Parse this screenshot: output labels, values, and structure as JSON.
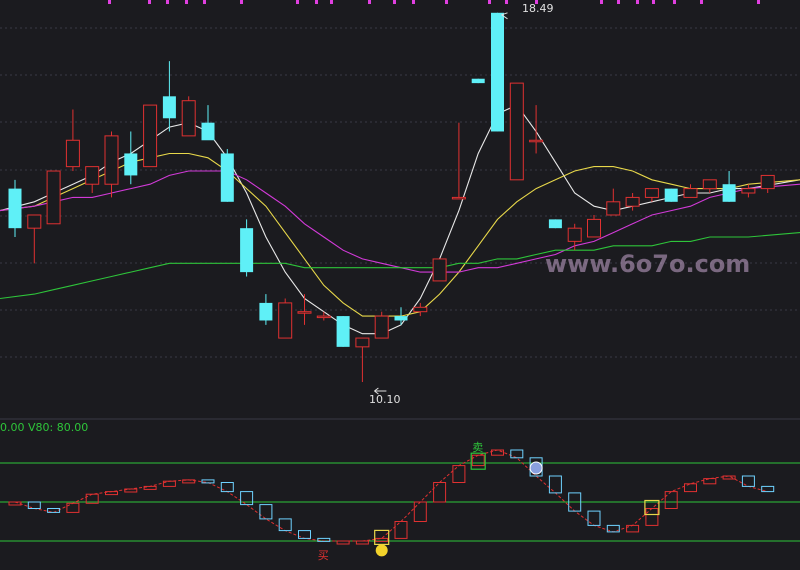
{
  "watermark": "www.6o7o.com",
  "main_chart": {
    "high_label": "18.49",
    "low_label": "10.10"
  },
  "indicator": {
    "header": "0.00  V80: 80.00",
    "icon_sell_text": "卖",
    "icon_buy_text": "买"
  },
  "colors": {
    "up": "#e03131",
    "down": "#5ff0f7",
    "ma_white": "#e8e8e8",
    "ma_yellow": "#e8d84a",
    "ma_magenta": "#d23ad8",
    "ma_green": "#2ec43a",
    "grid": "#3a3a44",
    "hline": "#2ec43a",
    "osc_line": "#e03131",
    "osc_box_up": "#e03131",
    "osc_box_down": "#6fd2ff",
    "signal_box": "#e8d84a",
    "signal_box_green": "#2ec43a",
    "header": "#2ec43a",
    "top_ticks": "#e040e0"
  },
  "chart_data": [
    {
      "type": "candlestick",
      "title": "",
      "annotations": [
        "18.49",
        "10.10"
      ],
      "ylim": [
        9.6,
        18.7
      ],
      "series": [
        {
          "name": "",
          "open": 14.5,
          "high": 14.7,
          "low": 13.4,
          "close": 13.6
        },
        {
          "name": "",
          "open": 13.6,
          "high": 13.8,
          "low": 12.8,
          "close": 13.9
        },
        {
          "name": "",
          "open": 13.7,
          "high": 14.9,
          "low": 13.7,
          "close": 14.9
        },
        {
          "name": "",
          "open": 15.0,
          "high": 16.3,
          "low": 14.9,
          "close": 15.6
        },
        {
          "name": "",
          "open": 14.6,
          "high": 15.0,
          "low": 14.4,
          "close": 15.0
        },
        {
          "name": "",
          "open": 14.6,
          "high": 15.8,
          "low": 14.3,
          "close": 15.7
        },
        {
          "name": "",
          "open": 15.3,
          "high": 15.8,
          "low": 14.6,
          "close": 14.8
        },
        {
          "name": "",
          "open": 15.0,
          "high": 16.2,
          "low": 15.0,
          "close": 16.4
        },
        {
          "name": "",
          "open": 16.6,
          "high": 17.4,
          "low": 15.8,
          "close": 16.1
        },
        {
          "name": "",
          "open": 15.7,
          "high": 16.6,
          "low": 15.7,
          "close": 16.5
        },
        {
          "name": "",
          "open": 16.0,
          "high": 16.4,
          "low": 15.7,
          "close": 15.6
        },
        {
          "name": "",
          "open": 15.3,
          "high": 15.4,
          "low": 14.2,
          "close": 14.2
        },
        {
          "name": "",
          "open": 13.6,
          "high": 13.8,
          "low": 12.5,
          "close": 12.6
        },
        {
          "name": "",
          "open": 11.9,
          "high": 12.1,
          "low": 11.4,
          "close": 11.5
        },
        {
          "name": "",
          "open": 11.1,
          "high": 12.0,
          "low": 11.1,
          "close": 11.9
        },
        {
          "name": "",
          "open": 11.7,
          "high": 12.1,
          "low": 11.4,
          "close": 11.7
        },
        {
          "name": "",
          "open": 11.6,
          "high": 11.7,
          "low": 11.5,
          "close": 11.6
        },
        {
          "name": "",
          "open": 11.6,
          "high": 11.6,
          "low": 10.9,
          "close": 10.9
        },
        {
          "name": "",
          "open": 10.9,
          "high": 11.1,
          "low": 10.1,
          "close": 11.1
        },
        {
          "name": "",
          "open": 11.1,
          "high": 11.7,
          "low": 11.1,
          "close": 11.6
        },
        {
          "name": "",
          "open": 11.6,
          "high": 11.8,
          "low": 11.4,
          "close": 11.5
        },
        {
          "name": "",
          "open": 11.7,
          "high": 11.9,
          "low": 11.6,
          "close": 11.8
        },
        {
          "name": "",
          "open": 12.4,
          "high": 12.9,
          "low": 12.4,
          "close": 12.9
        },
        {
          "name": "",
          "open": 14.3,
          "high": 16.0,
          "low": 14.3,
          "close": 14.3
        },
        {
          "name": "",
          "open": 17.0,
          "high": 17.0,
          "low": 16.9,
          "close": 16.9
        },
        {
          "name": "",
          "open": 18.5,
          "high": 18.5,
          "low": 15.8,
          "close": 15.8
        },
        {
          "name": "",
          "open": 14.7,
          "high": 16.9,
          "low": 14.7,
          "close": 16.9
        },
        {
          "name": "",
          "open": 15.6,
          "high": 16.4,
          "low": 15.3,
          "close": 15.6
        },
        {
          "name": "",
          "open": 13.8,
          "high": 13.8,
          "low": 13.6,
          "close": 13.6
        },
        {
          "name": "",
          "open": 13.3,
          "high": 13.7,
          "low": 13.1,
          "close": 13.6
        },
        {
          "name": "",
          "open": 13.4,
          "high": 13.9,
          "low": 13.4,
          "close": 13.8
        },
        {
          "name": "",
          "open": 13.9,
          "high": 14.5,
          "low": 13.9,
          "close": 14.2
        },
        {
          "name": "",
          "open": 14.1,
          "high": 14.4,
          "low": 14.0,
          "close": 14.3
        },
        {
          "name": "",
          "open": 14.3,
          "high": 14.5,
          "low": 14.2,
          "close": 14.5
        },
        {
          "name": "",
          "open": 14.5,
          "high": 14.5,
          "low": 14.2,
          "close": 14.2
        },
        {
          "name": "",
          "open": 14.3,
          "high": 14.6,
          "low": 14.3,
          "close": 14.5
        },
        {
          "name": "",
          "open": 14.5,
          "high": 14.7,
          "low": 14.4,
          "close": 14.7
        },
        {
          "name": "",
          "open": 14.6,
          "high": 14.9,
          "low": 14.2,
          "close": 14.2
        },
        {
          "name": "",
          "open": 14.4,
          "high": 14.6,
          "low": 14.3,
          "close": 14.5
        },
        {
          "name": "",
          "open": 14.5,
          "high": 14.8,
          "low": 14.4,
          "close": 14.8
        }
      ],
      "ma_lines": {
        "white": [
          14.0,
          14.2,
          14.4,
          14.6,
          14.8,
          15.1,
          15.3,
          15.6,
          15.9,
          16.0,
          15.8,
          15.2,
          14.4,
          13.4,
          12.6,
          12.0,
          11.7,
          11.4,
          11.2,
          11.2,
          11.4,
          12.0,
          12.9,
          14.0,
          15.3,
          16.2,
          16.4,
          15.8,
          15.1,
          14.4,
          14.1,
          14.0,
          14.1,
          14.2,
          14.3,
          14.4,
          14.4,
          14.5,
          14.5,
          14.7
        ],
        "yellow": [
          14.0,
          14.1,
          14.3,
          14.5,
          14.7,
          14.9,
          15.1,
          15.2,
          15.3,
          15.3,
          15.2,
          14.9,
          14.5,
          14.1,
          13.5,
          12.9,
          12.3,
          11.9,
          11.6,
          11.6,
          11.6,
          11.7,
          12.1,
          12.6,
          13.2,
          13.8,
          14.2,
          14.5,
          14.7,
          14.9,
          15.0,
          15.0,
          14.9,
          14.7,
          14.6,
          14.5,
          14.5,
          14.5,
          14.6,
          14.7
        ],
        "magenta": [
          14.0,
          14.1,
          14.2,
          14.3,
          14.3,
          14.4,
          14.5,
          14.6,
          14.8,
          14.9,
          14.9,
          14.9,
          14.7,
          14.4,
          14.1,
          13.7,
          13.4,
          13.1,
          12.9,
          12.8,
          12.7,
          12.6,
          12.6,
          12.6,
          12.7,
          12.7,
          12.8,
          12.9,
          13.0,
          13.2,
          13.3,
          13.5,
          13.7,
          13.9,
          14.0,
          14.1,
          14.3,
          14.4,
          14.5,
          14.6
        ],
        "green": [
          12.0,
          12.1,
          12.2,
          12.3,
          12.4,
          12.5,
          12.6,
          12.7,
          12.8,
          12.8,
          12.8,
          12.8,
          12.8,
          12.8,
          12.8,
          12.7,
          12.7,
          12.7,
          12.7,
          12.7,
          12.7,
          12.7,
          12.7,
          12.8,
          12.8,
          12.9,
          12.9,
          13.0,
          13.1,
          13.1,
          13.1,
          13.2,
          13.2,
          13.2,
          13.3,
          13.3,
          13.4,
          13.4,
          13.4,
          13.5
        ]
      }
    },
    {
      "type": "line",
      "title": "",
      "ylim": [
        0,
        100
      ],
      "hlines": [
        80,
        50,
        20
      ],
      "values": [
        50,
        45,
        42,
        49,
        56,
        58,
        60,
        62,
        66,
        67,
        65,
        58,
        48,
        37,
        28,
        22,
        20,
        20,
        20,
        22,
        35,
        50,
        65,
        78,
        86,
        90,
        84,
        70,
        57,
        43,
        32,
        27,
        32,
        45,
        58,
        64,
        68,
        70,
        62,
        58
      ],
      "signals": {
        "sell": [
          24
        ],
        "buy": [
          16
        ],
        "top": [
          27
        ],
        "bottom": [
          19,
          33
        ]
      }
    }
  ]
}
